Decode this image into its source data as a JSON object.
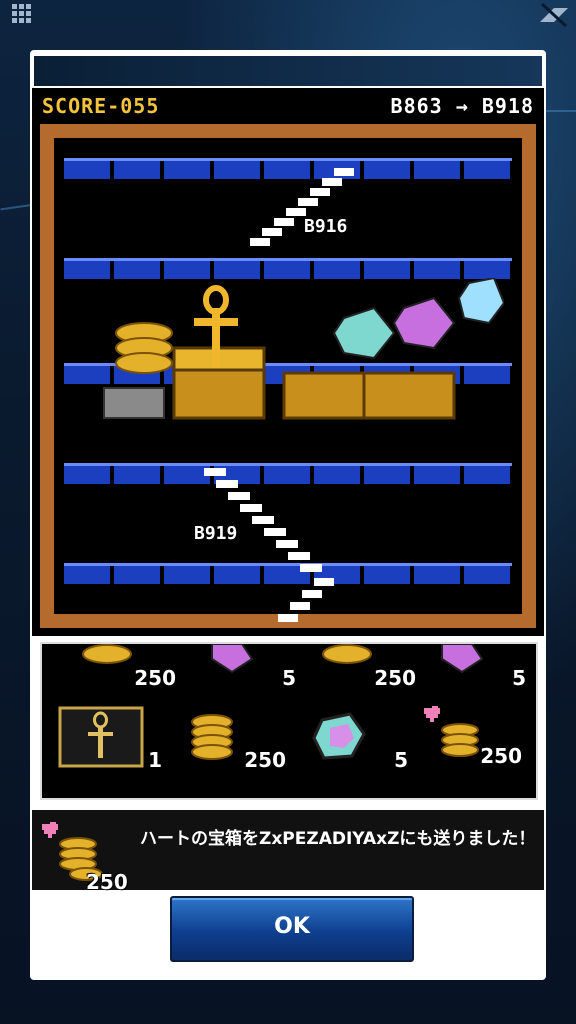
{
  "game": {
    "score": "SCORE-055",
    "floor_progress": "B863 → B918",
    "floor_upper": "B916",
    "floor_lower": "B919"
  },
  "rewards": [
    {
      "icon": "coin-stack-icon",
      "qty": "250"
    },
    {
      "icon": "gem-icon",
      "qty": "5"
    },
    {
      "icon": "coin-stack-icon",
      "qty": "250"
    },
    {
      "icon": "gem-icon",
      "qty": "5"
    },
    {
      "icon": "ankh-card-icon",
      "qty": "1"
    },
    {
      "icon": "coin-stack-icon",
      "qty": "250"
    },
    {
      "icon": "gem-icon",
      "qty": "5"
    },
    {
      "icon": "heart-coin-icon",
      "qty": "250"
    }
  ],
  "message": {
    "text": "ハートの宝箱をZxPEZADIYAxZにも送りました！",
    "qty": "250"
  },
  "ok_label": "OK",
  "colors": {
    "score": "#f3c43b",
    "brick": "#b56a2e",
    "floor_blue": "#1b3fbf",
    "button": "#1f5fb3"
  }
}
